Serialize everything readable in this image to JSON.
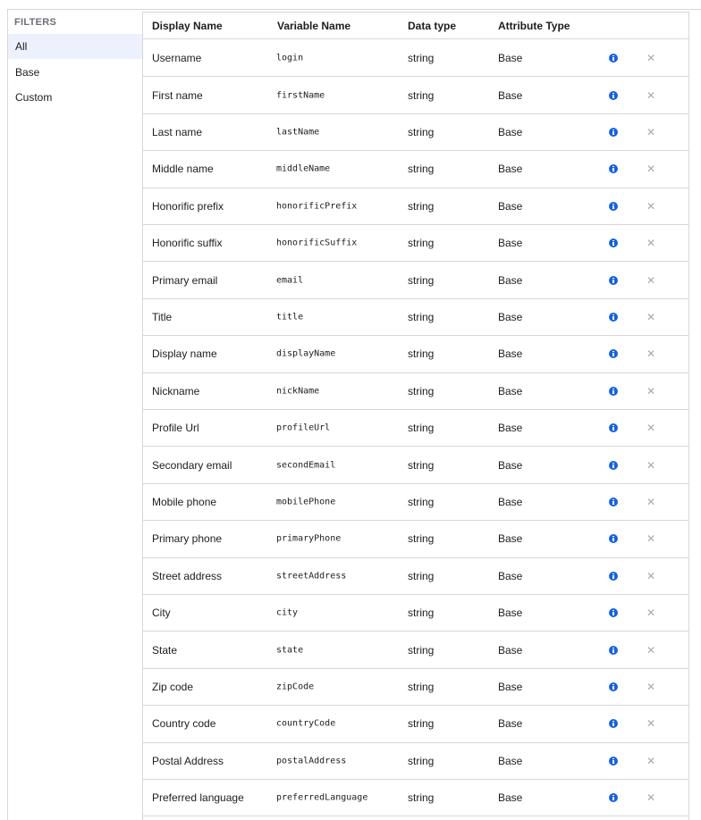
{
  "filters": {
    "title": "FILTERS",
    "items": [
      {
        "label": "All",
        "active": true
      },
      {
        "label": "Base",
        "active": false
      },
      {
        "label": "Custom",
        "active": false
      }
    ]
  },
  "table": {
    "headers": {
      "display_name": "Display Name",
      "variable_name": "Variable Name",
      "data_type": "Data type",
      "attribute_type": "Attribute Type"
    },
    "rows": [
      {
        "display_name": "Username",
        "variable_name": "login",
        "data_type": "string",
        "attribute_type": "Base"
      },
      {
        "display_name": "First name",
        "variable_name": "firstName",
        "data_type": "string",
        "attribute_type": "Base"
      },
      {
        "display_name": "Last name",
        "variable_name": "lastName",
        "data_type": "string",
        "attribute_type": "Base"
      },
      {
        "display_name": "Middle name",
        "variable_name": "middleName",
        "data_type": "string",
        "attribute_type": "Base"
      },
      {
        "display_name": "Honorific prefix",
        "variable_name": "honorificPrefix",
        "data_type": "string",
        "attribute_type": "Base"
      },
      {
        "display_name": "Honorific suffix",
        "variable_name": "honorificSuffix",
        "data_type": "string",
        "attribute_type": "Base"
      },
      {
        "display_name": "Primary email",
        "variable_name": "email",
        "data_type": "string",
        "attribute_type": "Base"
      },
      {
        "display_name": "Title",
        "variable_name": "title",
        "data_type": "string",
        "attribute_type": "Base"
      },
      {
        "display_name": "Display name",
        "variable_name": "displayName",
        "data_type": "string",
        "attribute_type": "Base"
      },
      {
        "display_name": "Nickname",
        "variable_name": "nickName",
        "data_type": "string",
        "attribute_type": "Base"
      },
      {
        "display_name": "Profile Url",
        "variable_name": "profileUrl",
        "data_type": "string",
        "attribute_type": "Base"
      },
      {
        "display_name": "Secondary email",
        "variable_name": "secondEmail",
        "data_type": "string",
        "attribute_type": "Base"
      },
      {
        "display_name": "Mobile phone",
        "variable_name": "mobilePhone",
        "data_type": "string",
        "attribute_type": "Base"
      },
      {
        "display_name": "Primary phone",
        "variable_name": "primaryPhone",
        "data_type": "string",
        "attribute_type": "Base"
      },
      {
        "display_name": "Street address",
        "variable_name": "streetAddress",
        "data_type": "string",
        "attribute_type": "Base"
      },
      {
        "display_name": "City",
        "variable_name": "city",
        "data_type": "string",
        "attribute_type": "Base"
      },
      {
        "display_name": "State",
        "variable_name": "state",
        "data_type": "string",
        "attribute_type": "Base"
      },
      {
        "display_name": "Zip code",
        "variable_name": "zipCode",
        "data_type": "string",
        "attribute_type": "Base"
      },
      {
        "display_name": "Country code",
        "variable_name": "countryCode",
        "data_type": "string",
        "attribute_type": "Base"
      },
      {
        "display_name": "Postal Address",
        "variable_name": "postalAddress",
        "data_type": "string",
        "attribute_type": "Base"
      },
      {
        "display_name": "Preferred language",
        "variable_name": "preferredLanguage",
        "data_type": "string",
        "attribute_type": "Base"
      }
    ],
    "row_icons": {
      "info": "info-icon",
      "remove": "close-icon"
    }
  },
  "colors": {
    "accent": "#1662dd",
    "active_filter_bg": "#edf1fd",
    "border": "#d7d7dc"
  }
}
